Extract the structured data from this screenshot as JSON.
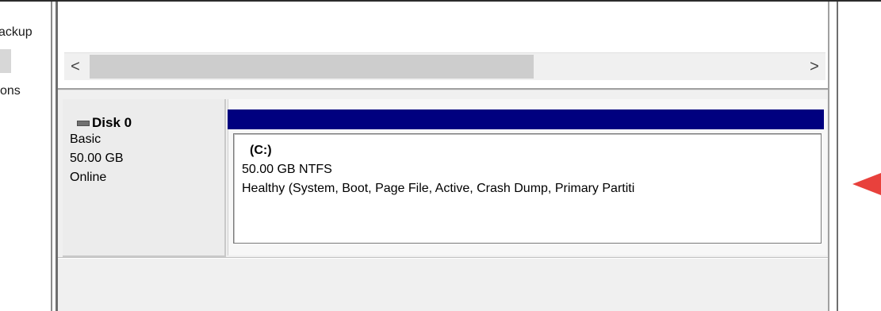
{
  "nav": {
    "items": [
      {
        "label": "ackup"
      },
      {
        "label": "ons"
      }
    ]
  },
  "volume_list": {
    "scroll_left_glyph": "<",
    "scroll_right_glyph": ">"
  },
  "disk": {
    "name": "Disk 0",
    "type": "Basic",
    "size": "50.00 GB",
    "status": "Online",
    "icon": "disk-drive-icon"
  },
  "partition": {
    "label": "(C:)",
    "filesystem": "50.00 GB NTFS",
    "status": "Healthy (System, Boot, Page File, Active, Crash Dump, Primary Partiti",
    "bar_color": "#00007f"
  },
  "annotation": {
    "arrow_color": "#e8413c",
    "icon": "red-pointer-arrow-icon"
  }
}
